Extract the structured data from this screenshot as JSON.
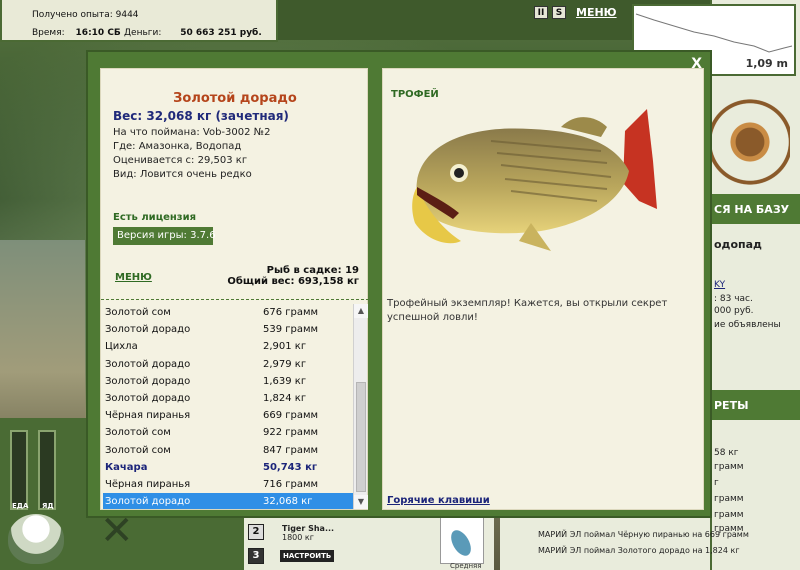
{
  "status": {
    "exp_label": "Получено опыта:",
    "exp_value": "9444",
    "time_label": "Время:",
    "time_value": "16:10 СБ",
    "money_label": "Деньги:",
    "money_value": "50 663 251 руб."
  },
  "top_icons": {
    "pause": "II",
    "s": "S",
    "menu": "МЕНЮ"
  },
  "depth": {
    "value": "1,09 m"
  },
  "right_panel": {
    "header1": "СЯ НА БАЗУ",
    "location": "одопад",
    "link": "KY",
    "line1": ": 83 час.",
    "line2": "000 руб.",
    "line3": "ие объявлены",
    "header2": "РЕТЫ",
    "r1": "58 кг",
    "r2": "грамм",
    "r3": "г",
    "r4": "грамм",
    "r5": "грамм",
    "r6": "грамм"
  },
  "bottom": {
    "gauge1": "ЕДА",
    "gauge2": "ЯД",
    "slot2": "2",
    "slot3": "3",
    "tiger_name": "Tiger Sha...",
    "tiger_weight": "1800 кг",
    "nastroit": "НАСТРОИТЬ",
    "lure_size": "Средняя",
    "log1": "МАРИЙ ЭЛ поймал Чёрную пиранью на 669 грамм",
    "log2": "МАРИЙ ЭЛ поймал Золотого дорадо на 1,824 кг"
  },
  "dialog": {
    "close": "X",
    "title": "Золотой дорадо",
    "weight": "Вес: 32,068 кг (зачетная)",
    "caught_on": "На что поймана: Vob-3002 №2",
    "where": "Где: Амазонка, Водопад",
    "valued": "Оценивается с: 29,503 кг",
    "kind": "Вид: Ловится очень редко",
    "license": "Есть лицензия",
    "version_label": "Версия игры:",
    "version_value": "3.7.6",
    "menu": "МЕНЮ",
    "keep_count": "Рыб в садке: 19",
    "keep_weight": "Общий вес: 693,158 кг",
    "trophy_label": "ТРОФЕЙ",
    "trophy_text": "Трофейный экземпляр! Кажется, вы открыли секрет успешной ловли!",
    "hotkeys": "Горячие клавиши",
    "fish_list": [
      {
        "name": "Золотой сом",
        "weight": "676 грамм"
      },
      {
        "name": "Золотой дорадо",
        "weight": "539 грамм"
      },
      {
        "name": "Цихла",
        "weight": "2,901 кг"
      },
      {
        "name": "Золотой дорадо",
        "weight": "2,979 кг"
      },
      {
        "name": "Золотой дорадо",
        "weight": "1,639 кг"
      },
      {
        "name": "Золотой дорадо",
        "weight": "1,824 кг"
      },
      {
        "name": "Чёрная пиранья",
        "weight": "669 грамм"
      },
      {
        "name": "Золотой сом",
        "weight": "922 грамм"
      },
      {
        "name": "Золотой сом",
        "weight": "847 грамм"
      },
      {
        "name": "Качара",
        "weight": "50,743 кг",
        "highlight": true
      },
      {
        "name": "Чёрная пиранья",
        "weight": "716 грамм"
      },
      {
        "name": "Золотой дорадо",
        "weight": "32,068 кг",
        "selected": true
      }
    ]
  }
}
